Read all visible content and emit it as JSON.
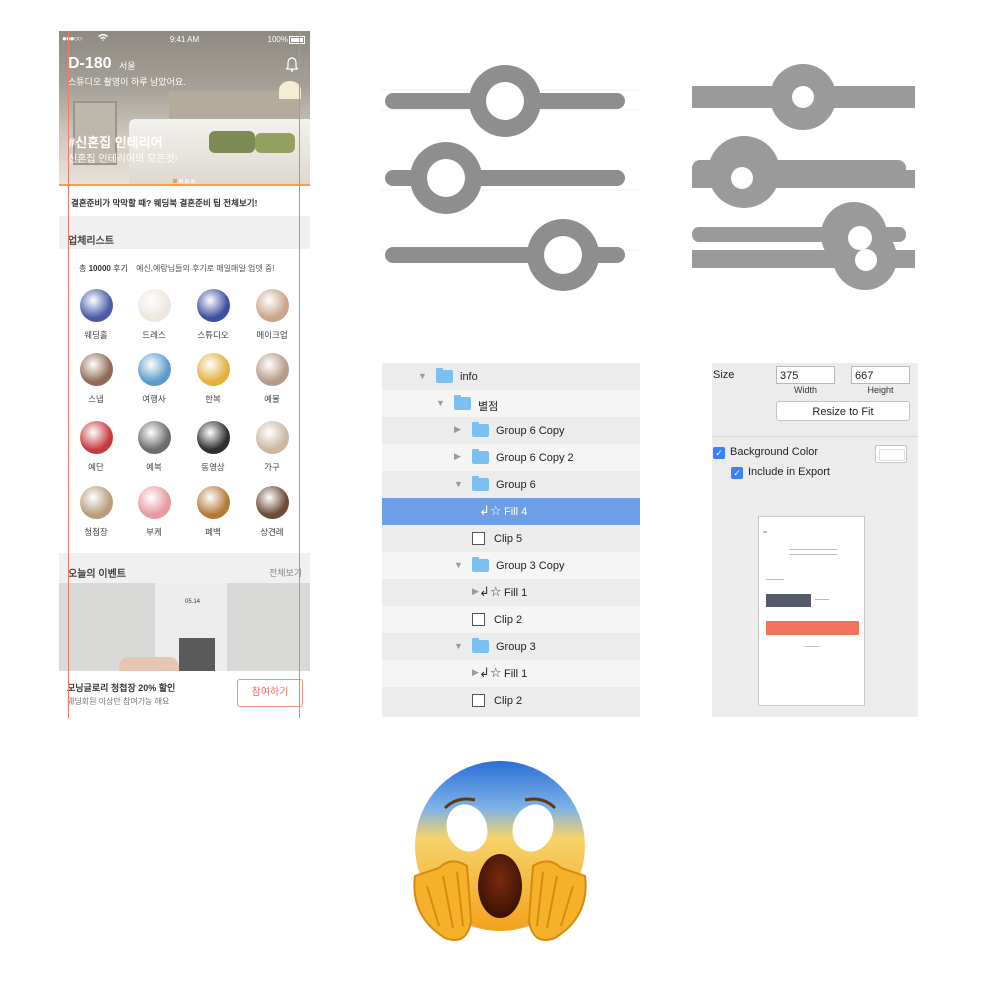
{
  "phone": {
    "status": {
      "signal": "●●●○○",
      "time": "9:41 AM",
      "battery": "100%"
    },
    "header": {
      "dday": "D-180",
      "city": "서울",
      "subtitle": "스튜디오 촬영이 하루 남았어요."
    },
    "hero": {
      "tag_title": "#신혼집 인테리어",
      "tag_subtitle": "신혼집 인테리어의 모든것!"
    },
    "banner": {
      "text": "결혼준비가 막막할 때? 웨딩북 결혼준비 팁 전체보기!"
    },
    "vendors": {
      "title": "업체리스트",
      "review_prefix": "총",
      "review_count": "10000",
      "review_suffix": "후기",
      "review_note": "예신,예랑님들의 후기로 매일매일 업뎃 중!",
      "categories": [
        {
          "label": "웨딩홀",
          "color": "#4a5ba8"
        },
        {
          "label": "드레스",
          "color": "#ece7df"
        },
        {
          "label": "스튜디오",
          "color": "#3e4ea0"
        },
        {
          "label": "메이크업",
          "color": "#c9a58c"
        },
        {
          "label": "스냅",
          "color": "#8f6b57"
        },
        {
          "label": "여행사",
          "color": "#5b9bc9"
        },
        {
          "label": "한복",
          "color": "#e3b03c"
        },
        {
          "label": "예물",
          "color": "#b59a88"
        },
        {
          "label": "예단",
          "color": "#c73a40"
        },
        {
          "label": "예복",
          "color": "#6c6c6c"
        },
        {
          "label": "동영상",
          "color": "#2e2e2e"
        },
        {
          "label": "가구",
          "color": "#c9b7a3"
        },
        {
          "label": "청첩장",
          "color": "#b89c7d"
        },
        {
          "label": "부케",
          "color": "#e79aa2"
        },
        {
          "label": "폐백",
          "color": "#b37a3a"
        },
        {
          "label": "상견례",
          "color": "#6b4a38"
        }
      ]
    },
    "events": {
      "title": "오늘의 이벤트",
      "more": "전체보기",
      "card_date": "05.14",
      "event_title": "모닝글로리 청첩장 20% 할인",
      "event_sub": "웨딩회원 이상만 참여가능 해요",
      "join_label": "참여하기"
    }
  },
  "layers_panel": {
    "rows": [
      {
        "label": "info",
        "kind": "folder",
        "expanded": true
      },
      {
        "label": "별점",
        "kind": "folder",
        "expanded": true
      },
      {
        "label": "Group 6 Copy",
        "kind": "folder",
        "expanded": false
      },
      {
        "label": "Group 6 Copy 2",
        "kind": "folder",
        "expanded": false
      },
      {
        "label": "Group 6",
        "kind": "folder",
        "expanded": true
      },
      {
        "label": "Fill 4",
        "kind": "shape",
        "selected": true
      },
      {
        "label": "Clip 5",
        "kind": "mask"
      },
      {
        "label": "Group 3 Copy",
        "kind": "folder",
        "expanded": true
      },
      {
        "label": "Fill 1",
        "kind": "shape"
      },
      {
        "label": "Clip 2",
        "kind": "mask"
      },
      {
        "label": "Group 3",
        "kind": "folder",
        "expanded": true
      },
      {
        "label": "Fill 1",
        "kind": "shape"
      },
      {
        "label": "Clip 2",
        "kind": "mask"
      }
    ],
    "selection_color": "#6d9ee6",
    "folder_color": "#7cc0f0"
  },
  "inspector": {
    "size_label": "Size",
    "width_value": "375",
    "height_value": "667",
    "width_label": "Width",
    "height_label": "Height",
    "resize_label": "Resize to Fit",
    "background_color_label": "Background Color",
    "include_export_label": "Include in Export"
  },
  "icons": {
    "sliders": "sliders-icon",
    "emoji": "face-screaming-in-fear-emoji"
  }
}
